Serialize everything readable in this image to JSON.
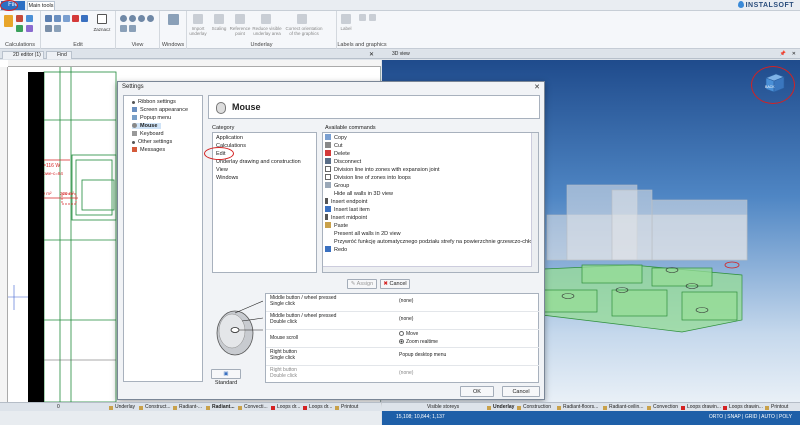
{
  "ribbon": {
    "file_tab": "File",
    "main_tab": "Main tools",
    "logo": "INSTALSOFT",
    "groups": {
      "calculations": "Calculations",
      "edit": "Edit",
      "view": "View",
      "windows": "Windows",
      "underlay": "Underlay",
      "labels": "Labels and graphics"
    },
    "buttons": {
      "zaznacz": "Zaznacz",
      "import_underlay": "Import underlay",
      "scaling": "Scaling",
      "reference_point": "Reference point",
      "reduce_visible": "Reduce visible underlay area",
      "correct_orientation": "Correct orientation of the graphics",
      "label": "Label"
    }
  },
  "doc_tabs": {
    "editor": "2D editor (1)",
    "find": "Find",
    "view3d": "3D view"
  },
  "dialog": {
    "title": "Settings",
    "close": "✕",
    "tree": [
      {
        "label": "Ribbon settings",
        "bullet": true
      },
      {
        "label": "Screen appearance"
      },
      {
        "label": "Popup menu"
      },
      {
        "label": "Mouse"
      },
      {
        "label": "Keyboard"
      },
      {
        "label": "Other settings",
        "bullet": true
      },
      {
        "label": "Messages"
      }
    ],
    "panel_title": "Mouse",
    "category_label": "Category",
    "commands_label": "Available commands",
    "categories": [
      "Application",
      "Calculations",
      "Edit",
      "Underlay drawing and construction",
      "View",
      "Windows"
    ],
    "commands": [
      "Copy",
      "Cut",
      "Delete",
      "Disconnect",
      "Division line into zones with expansion joint",
      "Division line of zones into loops",
      "Group",
      "Hide all walls in 3D view",
      "Insert endpoint",
      "Insert last item",
      "Insert midpoint",
      "Paste",
      "Present all walls in 2D view",
      "Przywróć funkcję automatycznego podziału strefy na powierzchnie grzewczo-chłodzące (pe",
      "Redo"
    ],
    "assign": "Assign",
    "cancel_assign": "Cancel",
    "standard": "Standard",
    "bindings": [
      {
        "name": "Middle button / wheel pressed\nSingle click",
        "value": "(none)"
      },
      {
        "name": "Middle button / wheel pressed\nDouble click",
        "value": "(none)"
      },
      {
        "name": "Mouse scroll",
        "options": [
          "Move",
          "Zoom realtime"
        ],
        "selected": "Zoom realtime"
      },
      {
        "name": "Right button\nSingle click",
        "value": "Popup desktop menu"
      },
      {
        "name": "Right button\nDouble click",
        "value": "(none)"
      }
    ],
    "ok": "OK",
    "cancel": "Cancel"
  },
  "editor": {
    "annotation1": "ø=116 W",
    "annotation2": "Nowe-c=84",
    "annotation3": "20 m²",
    "annotation4": "200 m²"
  },
  "status_left": {
    "zero": "0",
    "tabs": [
      "Underlay",
      "Construct...",
      "Radiant-...",
      "Radiant...",
      "Convecti...",
      "Loops dr...",
      "Loops dr...",
      "Printout"
    ]
  },
  "status_right": {
    "visible": "Visible storeys",
    "tabs": [
      "Underlay",
      "Construction",
      "Radiant-floors...",
      "Radiant-ceilin...",
      "Convection",
      "Loops drawin...",
      "Loops drawin...",
      "Printout"
    ],
    "coords": "15,108; 10,844; 1,137",
    "modes": "ORTO | SNAP | GRID | AUTO | POLY"
  },
  "cube_label": "BACK",
  "colors": {
    "accent": "#2b6fc4",
    "annotation": "#d42222",
    "selected": "#cfe3f7"
  }
}
